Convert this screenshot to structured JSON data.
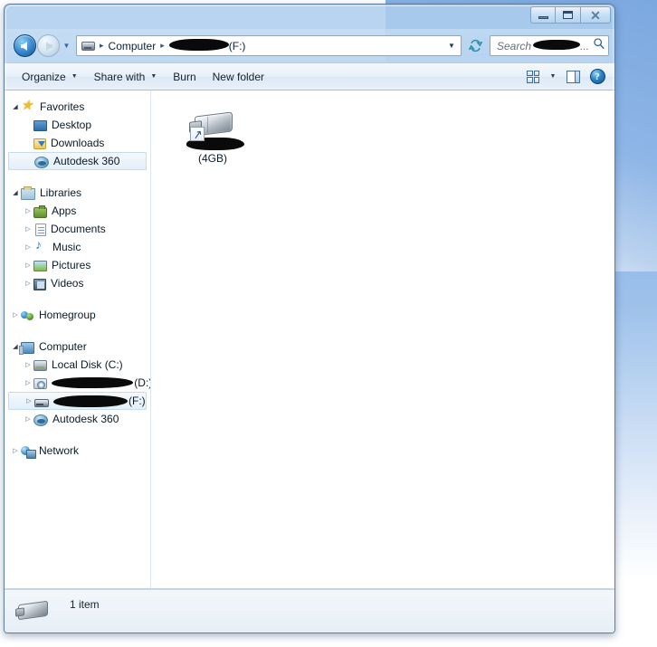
{
  "window": {
    "controls": {
      "minimize_label": "Minimize",
      "maximize_label": "Maximize",
      "close_label": "Close"
    }
  },
  "address": {
    "back_label": "Back",
    "forward_label": "Forward",
    "recent_label": "Recent pages",
    "drive_icon": "usb-drive-icon",
    "crumb_computer": "Computer",
    "crumb_separator": "▸",
    "crumb_drive_letter": "(F:)",
    "crumb_drive_name_redacted": true,
    "dropdown_glyph": "▼",
    "refresh_label": "Refresh"
  },
  "search": {
    "placeholder_prefix": "Search",
    "placeholder_suffix": "...",
    "name_redacted": true,
    "icon": "magnifier-icon"
  },
  "toolbar": {
    "items": [
      {
        "label": "Organize",
        "has_caret": true
      },
      {
        "label": "Share with",
        "has_caret": true
      },
      {
        "label": "Burn",
        "has_caret": false
      },
      {
        "label": "New folder",
        "has_caret": false
      }
    ],
    "views_icon": "views-grid-icon",
    "views_caret": "▼",
    "preview_pane_icon": "preview-pane-icon",
    "help_icon": "help-icon",
    "help_glyph": "?"
  },
  "sidebar": {
    "groups": [
      {
        "root": {
          "label": "Favorites",
          "icon": "star-icon",
          "twisty": "◢",
          "expanded": true
        },
        "items": [
          {
            "label": "Desktop",
            "icon": "desktop-icon",
            "twisty": "",
            "selected": false
          },
          {
            "label": "Downloads",
            "icon": "download-icon",
            "twisty": "",
            "selected": false
          },
          {
            "label": "Autodesk 360",
            "icon": "cloud-icon",
            "twisty": "",
            "selected": true
          }
        ]
      },
      {
        "root": {
          "label": "Libraries",
          "icon": "libraries-icon",
          "twisty": "◢",
          "expanded": true
        },
        "items": [
          {
            "label": "Apps",
            "icon": "apps-icon",
            "twisty": "▷",
            "selected": false
          },
          {
            "label": "Documents",
            "icon": "document-icon",
            "twisty": "▷",
            "selected": false
          },
          {
            "label": "Music",
            "icon": "music-icon",
            "twisty": "▷",
            "selected": false
          },
          {
            "label": "Pictures",
            "icon": "pictures-icon",
            "twisty": "▷",
            "selected": false
          },
          {
            "label": "Videos",
            "icon": "videos-icon",
            "twisty": "▷",
            "selected": false
          }
        ]
      },
      {
        "root": {
          "label": "Homegroup",
          "icon": "homegroup-icon",
          "twisty": "▷",
          "expanded": false
        },
        "items": []
      },
      {
        "root": {
          "label": "Computer",
          "icon": "computer-icon",
          "twisty": "◢",
          "expanded": true
        },
        "items": [
          {
            "label": "Local Disk (C:)",
            "icon": "hdd-icon",
            "twisty": "▷",
            "selected": false,
            "redacted": false
          },
          {
            "label": "(D:)",
            "icon": "disc-icon",
            "twisty": "▷",
            "selected": false,
            "redacted": true,
            "redact_width": 108
          },
          {
            "label": "(F:)",
            "icon": "usb-icon",
            "twisty": "▷",
            "selected": true,
            "redacted": true,
            "redact_width": 86
          },
          {
            "label": "Autodesk 360",
            "icon": "cloud-icon",
            "twisty": "▷",
            "selected": false,
            "redacted": false
          }
        ]
      },
      {
        "root": {
          "label": "Network",
          "icon": "network-icon",
          "twisty": "▷",
          "expanded": false
        },
        "items": []
      }
    ]
  },
  "content": {
    "items": [
      {
        "icon": "usb-drive-shortcut-icon",
        "name_redacted": true,
        "size_label": "(4GB)",
        "shortcut_overlay": true,
        "shortcut_glyph": "↗"
      }
    ]
  },
  "status": {
    "icon": "usb-drive-icon",
    "item_count_text": "1 item"
  },
  "colors": {
    "window_frame": "#5c7f9e",
    "title_glass": "#8cb9e8",
    "selection_border": "#c3dcf0",
    "desktop_blue": "#83ade2",
    "accent_blue": "#2f7fc2"
  }
}
